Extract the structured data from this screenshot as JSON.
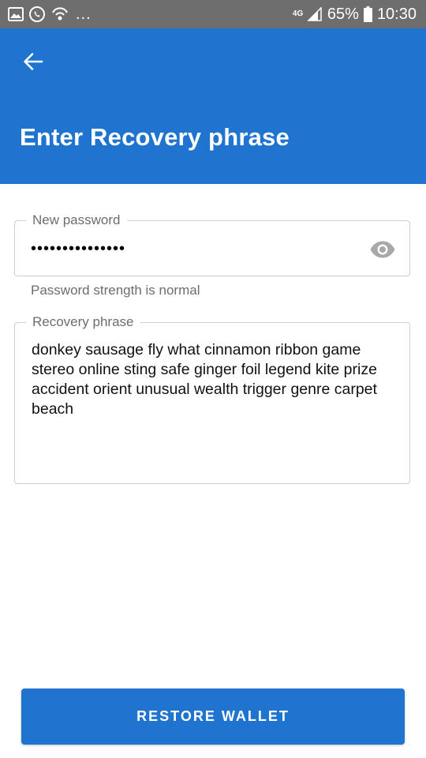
{
  "status_bar": {
    "left_icons": [
      "gallery-icon",
      "phone-call-icon",
      "wifi-calling-icon"
    ],
    "overflow_text": "...",
    "network_type": "4G",
    "battery_percent": "65%",
    "time": "10:30"
  },
  "app_bar": {
    "back_icon": "arrow-back-icon",
    "title": "Enter Recovery phrase",
    "background_color": "#1f74cf"
  },
  "form": {
    "password": {
      "label": "New password",
      "value": "•••••••••••••••",
      "toggle_icon": "eye-icon",
      "helper_text": "Password strength is normal"
    },
    "recovery_phrase": {
      "label": "Recovery phrase",
      "value": "donkey sausage fly what cinnamon ribbon game stereo online sting safe ginger foil legend kite prize accident orient unusual wealth trigger genre carpet beach"
    }
  },
  "actions": {
    "restore_label": "RESTORE WALLET"
  }
}
